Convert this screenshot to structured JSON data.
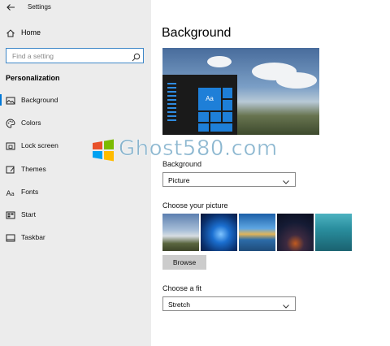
{
  "window": {
    "title": "Settings"
  },
  "sidebar": {
    "home_label": "Home",
    "search_placeholder": "Find a setting",
    "section_title": "Personalization",
    "items": [
      {
        "label": "Background",
        "icon": "picture-icon",
        "active": true
      },
      {
        "label": "Colors",
        "icon": "palette-icon",
        "active": false
      },
      {
        "label": "Lock screen",
        "icon": "lock-screen-icon",
        "active": false
      },
      {
        "label": "Themes",
        "icon": "brush-icon",
        "active": false
      },
      {
        "label": "Fonts",
        "icon": "font-icon",
        "active": false
      },
      {
        "label": "Start",
        "icon": "start-icon",
        "active": false
      },
      {
        "label": "Taskbar",
        "icon": "taskbar-icon",
        "active": false
      }
    ]
  },
  "main": {
    "title": "Background",
    "preview_tile_text": "Aa",
    "background_label": "Background",
    "background_value": "Picture",
    "choose_picture_label": "Choose your picture",
    "browse_label": "Browse",
    "fit_label": "Choose a fit",
    "fit_value": "Stretch"
  },
  "watermark": {
    "text": "Ghost580.com"
  },
  "colors": {
    "accent": "#0078d7",
    "sidebar_bg": "#ececec",
    "button_bg": "#cccccc"
  }
}
